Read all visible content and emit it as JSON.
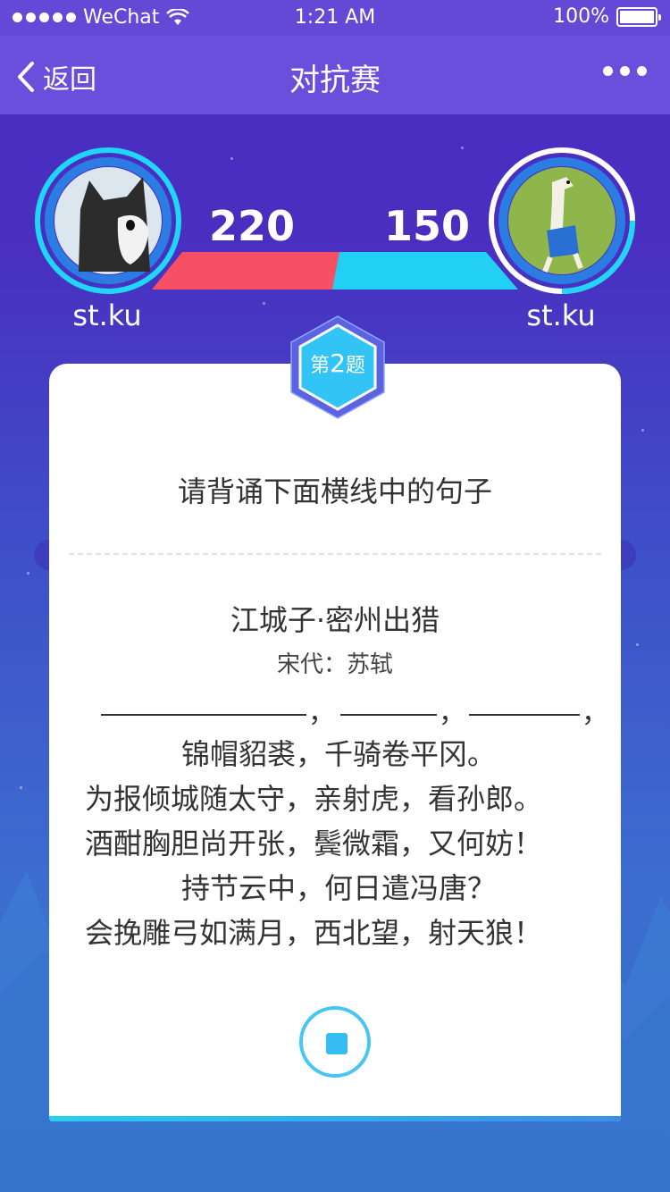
{
  "status_bar": {
    "carrier": "WeChat",
    "time": "1:21 AM",
    "battery": "100%"
  },
  "nav": {
    "back_label": "返回",
    "title": "对抗赛"
  },
  "players": [
    {
      "name": "st.ku",
      "score": "220",
      "avatar": "cat-avatar"
    },
    {
      "name": "st.ku",
      "score": "150",
      "avatar": "llama-avatar"
    }
  ],
  "colors": {
    "red_bar": "#f75064",
    "blue_bar": "#23d0f5",
    "accent": "#34bdf2"
  },
  "question": {
    "badge_prefix": "第",
    "badge_number": "2",
    "badge_suffix": "题",
    "prompt": "请背诵下面横线中的句子"
  },
  "poem": {
    "title": "江城子·密州出猎",
    "author": "宋代：苏轼",
    "blank_commas": [
      "，",
      "，",
      "，"
    ],
    "lines": [
      "锦帽貂裘，千骑卷平冈。",
      "为报倾城随太守，亲射虎，看孙郎。",
      "酒酣胸胆尚开张，鬓微霜，又何妨！",
      "持节云中，何日遣冯唐？",
      "会挽雕弓如满月，西北望，射天狼！"
    ]
  }
}
